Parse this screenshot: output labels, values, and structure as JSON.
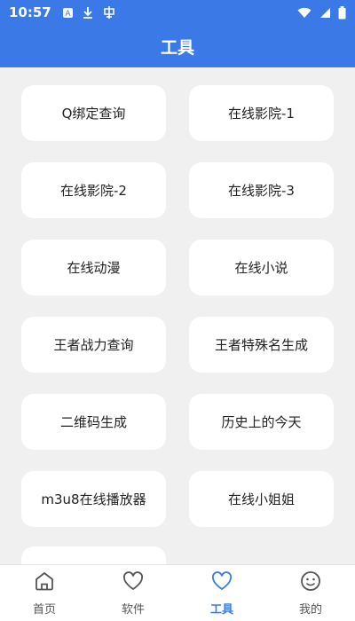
{
  "status_bar": {
    "time": "10:57",
    "icons": [
      "a-box-icon",
      "download-icon",
      "notification-app-icon"
    ],
    "right_icons": [
      "wifi-icon",
      "signal-icon",
      "battery-icon"
    ]
  },
  "header": {
    "title": "工具"
  },
  "tools": [
    "Q绑定查询",
    "在线影院-1",
    "在线影院-2",
    "在线影院-3",
    "在线动漫",
    "在线小说",
    "王者战力查询",
    "王者特殊名生成",
    "二维码生成",
    "历史上的今天",
    "m3u8在线播放器",
    "在线小姐姐"
  ],
  "bottom_nav": {
    "items": [
      {
        "label": "首页",
        "icon": "home-icon"
      },
      {
        "label": "软件",
        "icon": "heart-icon"
      },
      {
        "label": "工具",
        "icon": "heart-icon"
      },
      {
        "label": "我的",
        "icon": "smiley-icon"
      }
    ],
    "active_index": 2
  },
  "colors": {
    "primary": "#3b7ae6",
    "background": "#f0f0f0",
    "card": "#ffffff"
  }
}
